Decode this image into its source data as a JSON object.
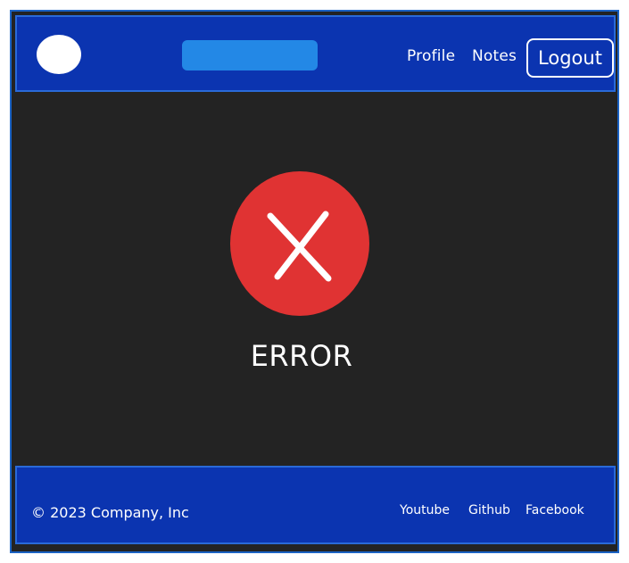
{
  "header": {
    "nav": {
      "profile_label": "Profile",
      "notes_label": "Notes",
      "logout_label": "Logout"
    }
  },
  "main": {
    "error_icon": "close-icon",
    "error_label": "ERROR"
  },
  "footer": {
    "copyright": "© 2023 Company, Inc",
    "links": {
      "youtube": "Youtube",
      "github": "Github",
      "facebook": "Facebook"
    }
  },
  "colors": {
    "header_bg": "#0b34b0",
    "body_bg": "#232323",
    "title_bar": "#2388e6",
    "error_red": "#e03333"
  }
}
